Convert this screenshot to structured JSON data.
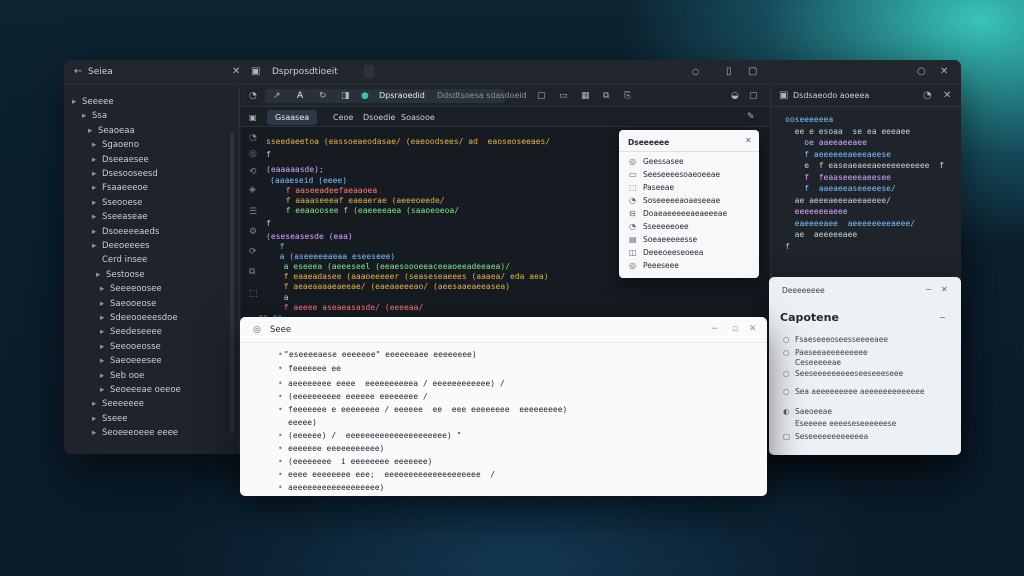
{
  "ide": {
    "sidebar_title": "Seiea",
    "tab_title": "Dsprposdtioeit",
    "toolbar_label": "Dpsraoedid",
    "toolbar_path": "Ddsdtsoesa  sdasdoeid",
    "tabs": [
      "Gsaasea",
      "Ceoe",
      "Dsoedie",
      "Soasooe"
    ],
    "right_header": "Dsdsaeodo aoeeea"
  },
  "tree": [
    "Seeeee",
    "Ssa",
    "Seaoeaa",
    "Sgaoeno",
    "Dseeaesee",
    "Dsesooseesd",
    "Fsaaeeeoe",
    "Sseooese",
    "Sseeaseae",
    "Dsoeeeeaeds",
    "Deeoeeees",
    "Cerd insee",
    "Sestoose",
    "Seeeeoosee",
    "Saeooeose",
    "Sdeeooeeesdoe",
    "Seedeseeee",
    "Seeooeosse",
    "Saeoeeesee",
    "Seb ooe",
    "Seoeeeae oeeoe",
    "Seeeeeee",
    "Sseee",
    "Seoeeeoeee eeee"
  ],
  "code_lines": [
    "sseedaeetoa (eassoeaeodasae/ (eaeoodsees/ ad  eaoseoseeaes/",
    "f",
    "(eaaaaasde);",
    "(aaaeseid (eeee)",
    "  f aaseeadeefaeaaoea",
    "  f aaaaseeeaf eaeaerae (aeeeoeede/",
    "  f eeaaoosee f (eaeeeeaea (saaoeoeoa/",
    "f",
    "(eseseasesde (eaa)",
    "  f",
    "  a (aseeeeeaeaa eseeseee)",
    "  a eseeea (aeeeseel (eeaesoooeeaceeaoeeadeeaea)/",
    "  f eaaeadasee (aaaoeeeeer (seaseseaeees (aaaea/ eda aea)",
    "  f aeaeaaaaeaeeae/ (eaeaaeeeao/ (aeesaaeaeeasea)",
    "  a",
    "  f aeeee aseaeasasde/ (eeeeaa/",
    "aa ea"
  ],
  "popup": {
    "title": "Dseeeeee",
    "items": [
      "Geessasee",
      "Seeseeeesoaeoeeae",
      "Paseeae",
      "Soseeeeeaoaeseeae",
      "Doaeaeeeeeaeaeeeae",
      "Sseeeeeoee",
      "Soeaeeeeesse",
      "Deeeoeeseoeea",
      "Peeeseee"
    ]
  },
  "right_code": [
    "ooseeeeeea",
    "  ee e esoaa  se ea eeeaee",
    "    oe aaeeaeeaee",
    "    f aeeeeeeaeeeaeese",
    "    e  f easeaeaeeaeeeeeeeeeee  f",
    "    f  feaaseeeeaeesee",
    "    f  aaeaeeaseeeeese/",
    "  ae aeeeaeeeaeeaeeee/",
    "  eeeeeeeaeee",
    "  eaeeeeaee  aeeeeeeeeaeee/",
    "  ae  aeeeeeaee",
    "f"
  ],
  "light_panel": {
    "header": "Deeeeeeee",
    "title": "Capotene",
    "rows": [
      "Fsaeseeeoseesseeeeaee",
      "Paeseeaeeeeeeeee",
      "Ceseeeeeae",
      "Seeseeeeeeeeeseeseeeseee",
      "Sea aeeeeeeeee aeeeeeeeeeeeee",
      "Saeoeeae",
      "Eseeeee eeeeseseeeeeese",
      "Seseeeeeeeeeeeea"
    ]
  },
  "dialog": {
    "title": "Seee",
    "lines": [
      "\"eseeeeaese eeeeeee\" eeeeeeaee eeeeeeee)",
      "feeeeeee ee",
      "aeeeeeeee eeee  eeeeeeeeeea / eeeeeeeeeeee) /",
      "(eeeeeeeeee eeeeee eeeeeeee /",
      "feeeeeee e eeeeeeee / eeeeee  ee  eee eeeeeeee  eeeeeeeee)",
      "eeeee)",
      "(eeeeee) /  eeeeeeeeeeeeeeeeeeeee) \"",
      "eeeeeee eeeeeeeeeee)",
      "(eeeeeeee  i eeeeeeee eeeeeee)",
      "eeee eeeeeeee eee;  eeeeeeeeeeeeeeeeeeee  /",
      "aeeeeeeeeeeeeeeeeee)"
    ]
  }
}
